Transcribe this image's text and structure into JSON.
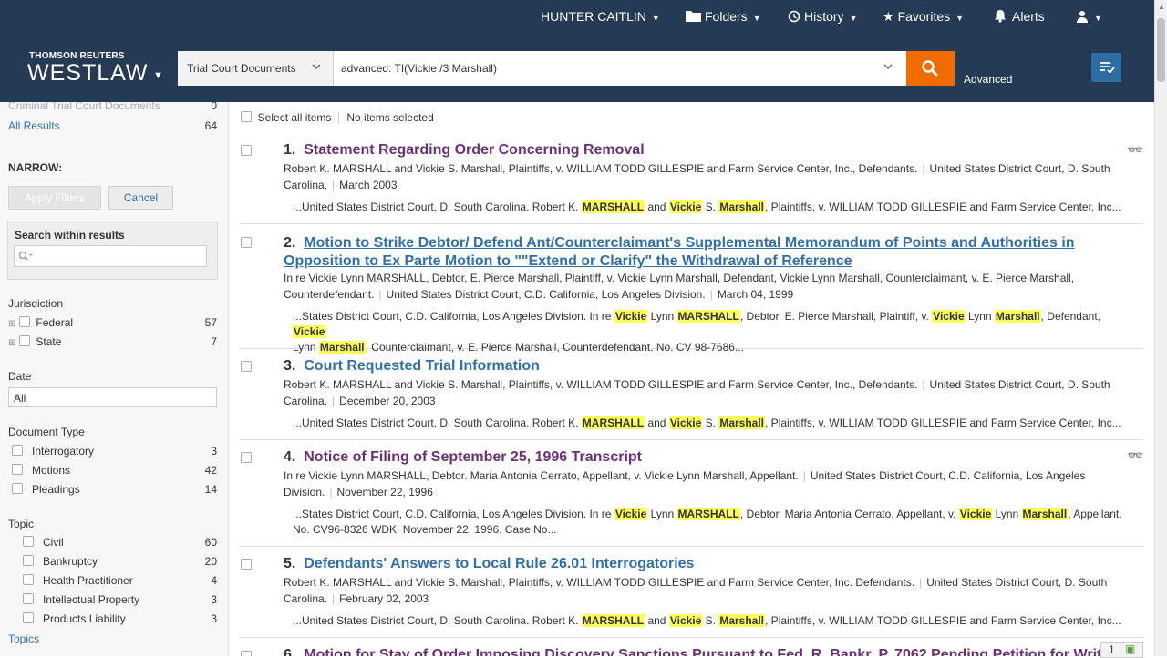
{
  "topnav": {
    "user": "HUNTER CAITLIN",
    "folders": "Folders",
    "history": "History",
    "favorites": "Favorites",
    "alerts": "Alerts"
  },
  "brand": {
    "company": "THOMSON REUTERS",
    "product": "WESTLAW"
  },
  "search": {
    "scope": "Trial Court Documents",
    "query": "advanced: TI(Vickie /3 Marshall)",
    "advanced_label": "Advanced"
  },
  "sidebar": {
    "criminal_label": "Criminal Trial Court Documents",
    "criminal_count": "0",
    "all_results_label": "All Results",
    "all_results_count": "64",
    "narrow": "NARROW:",
    "apply": "Apply Filters",
    "cancel": "Cancel",
    "search_within": "Search within results",
    "jurisdiction": {
      "title": "Jurisdiction",
      "items": [
        {
          "label": "Federal",
          "count": "57"
        },
        {
          "label": "State",
          "count": "7"
        }
      ]
    },
    "date": {
      "title": "Date",
      "value": "All"
    },
    "doctype": {
      "title": "Document Type",
      "items": [
        {
          "label": "Interrogatory",
          "count": "3"
        },
        {
          "label": "Motions",
          "count": "42"
        },
        {
          "label": "Pleadings",
          "count": "14"
        }
      ]
    },
    "topic": {
      "title": "Topic",
      "items": [
        {
          "label": "Civil",
          "count": "60"
        },
        {
          "label": "Bankruptcy",
          "count": "20"
        },
        {
          "label": "Health Practitioner",
          "count": "4"
        },
        {
          "label": "Intellectual Property",
          "count": "3"
        },
        {
          "label": "Products Liability",
          "count": "3"
        }
      ],
      "link": "Topics"
    }
  },
  "results_bar": {
    "select_all": "Select all items",
    "none_selected": "No items selected"
  },
  "results": [
    {
      "num": "1.",
      "title": "Statement Regarding Order Concerning Removal",
      "meta1": "Robert K. MARSHALL and Vickie S. Marshall, Plaintiffs, v. WILLIAM TODD GILLESPIE and Farm Service Center, Inc., Defendants.",
      "meta2": "United States District Court, D. South",
      "meta3": "Carolina.",
      "date": "March 2003",
      "snip": [
        "...United States District Court, D. South Carolina. Robert K. ",
        "MARSHALL",
        " and ",
        "Vickie",
        " S. ",
        "Marshall",
        ", Plaintiffs, v. WILLIAM TODD GILLESPIE and Farm Service Center, Inc..."
      ]
    },
    {
      "num": "2.",
      "title1": "Motion to Strike Debtor/ Defend Ant/Counterclaimant's Supplemental Memorandum of Points and Authorities in",
      "title2": "Opposition to Ex Parte Motion to \"\"Extend or Clarify\" the Withdrawal of Reference",
      "meta1": "In re Vickie Lynn MARSHALL, Debtor, E. Pierce Marshall, Plaintiff, v. Vickie Lynn Marshall, Defendant, Vickie Lynn Marshall, Counterclaimant, v. E. Pierce Marshall,",
      "meta2": "Counterdefendant.",
      "court": "United States District Court, C.D. California, Los Angeles Division.",
      "date": "March 04, 1999",
      "snip": [
        "...States District Court, C.D. California, Los Angeles Division. In re ",
        "Vickie",
        " Lynn ",
        "MARSHALL",
        ", Debtor, E. Pierce Marshall, Plaintiff, v. ",
        "Vickie",
        " Lynn ",
        "Marshall",
        ", Defendant, ",
        "Vickie"
      ],
      "snip2": [
        "Lynn ",
        "Marshall",
        ", Counterclaimant, v. E. Pierce Marshall, Counterdefendant. No. CV 98-7686..."
      ]
    },
    {
      "num": "3.",
      "title": "Court Requested Trial Information",
      "meta1": "Robert K. MARSHALL and Vickie S. Marshall, Plaintiffs, v. WILLIAM TODD GILLESPIE and Farm Service Center, Inc., Defendants.",
      "meta2": "United States District Court, D. South",
      "meta3": "Carolina.",
      "date": "December 20, 2003",
      "snip": [
        "...United States District Court, D. South Carolina. Robert K. ",
        "MARSHALL",
        " and ",
        "Vickie",
        " S. ",
        "Marshall",
        ", Plaintiffs, v. WILLIAM TODD GILLESPIE and Farm Service Center, Inc..."
      ]
    },
    {
      "num": "4.",
      "title": "Notice of Filing of September 25, 1996 Transcript",
      "meta1": "In re Vickie Lynn MARSHALL, Debtor. Maria Antonia Cerrato, Appellant, v. Vickie Lynn Marshall, Appellant.",
      "meta2": "United States District Court, C.D. California, Los Angeles",
      "meta3": "Division.",
      "date": "November 22, 1996",
      "snip": [
        "...States District Court, C.D. California, Los Angeles Division. In re ",
        "Vickie",
        " Lynn ",
        "MARSHALL",
        ", Debtor. Maria Antonia Cerrato, Appellant, v. ",
        "Vickie",
        " Lynn ",
        "Marshall",
        ", Appellant."
      ],
      "snip2": [
        "No. CV96-8326 WDK. November 22, 1996. Case No..."
      ]
    },
    {
      "num": "5.",
      "title": "Defendants' Answers to Local Rule 26.01 Interrogatories",
      "meta1": "Robert K. MARSHALL and Vickie S. Marshall, Plaintiffs, v. WILLIAM TODD GILLESPIE and Farm Service Center, Inc. Defendants.",
      "meta2": "United States District Court, D. South",
      "meta3": "Carolina.",
      "date": "February 02, 2003",
      "snip": [
        "...United States District Court, D. South Carolina. Robert K. ",
        "MARSHALL",
        " and ",
        "Vickie",
        " S. ",
        "Marshall",
        ", Plaintiffs, v. WILLIAM TODD GILLESPIE and Farm Service Center, Inc..."
      ]
    },
    {
      "num": "6.",
      "title": "Motion for Stay of Order Imposing Discovery Sanctions Pursuant to Fed. R. Bankr. P. 7062 Pending Petition for Writ"
    }
  ],
  "pager": {
    "page": "1"
  },
  "colors": {
    "header": "#253a55",
    "search_button": "#f06b00",
    "link": "#2f6fae",
    "visited": "#6b2f7a",
    "highlight": "#ffff5a"
  }
}
